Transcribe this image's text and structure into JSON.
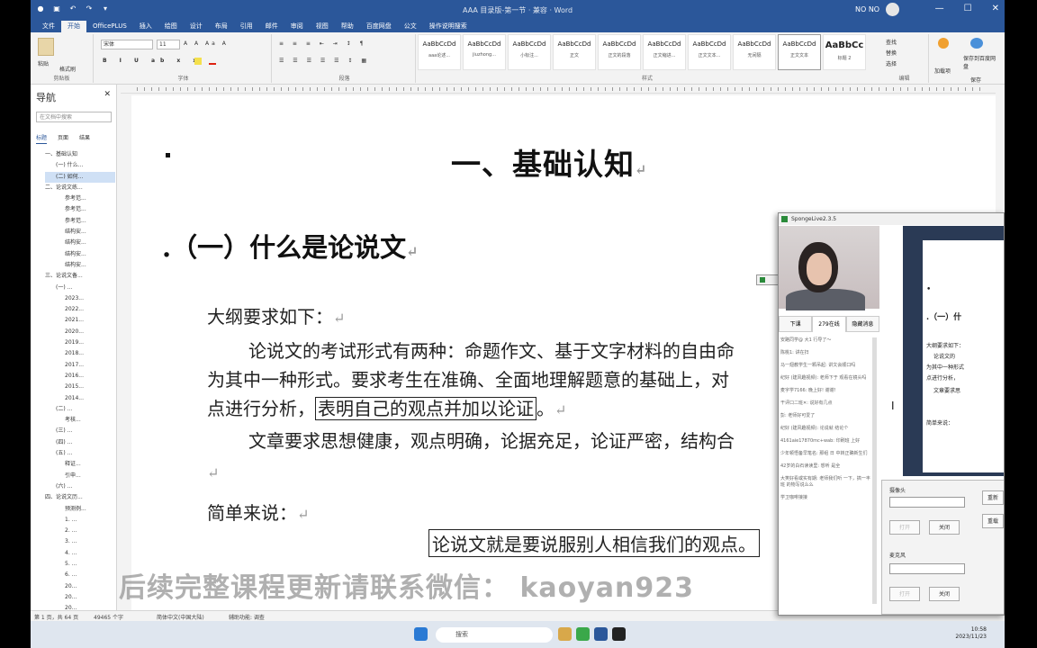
{
  "window": {
    "title": "AAA 目录版-第一节 · 兼容 · Word",
    "user": "NO NO"
  },
  "ribbon_tabs": [
    "文件",
    "开始",
    "OfficePLUS",
    "插入",
    "绘图",
    "设计",
    "布局",
    "引用",
    "邮件",
    "审阅",
    "视图",
    "帮助",
    "百度网盘",
    "公文",
    "操作说明搜索"
  ],
  "ribbon": {
    "clipboard": {
      "paste": "粘贴",
      "format_painter": "格式刷",
      "label": "剪贴板"
    },
    "font": {
      "name": "宋体",
      "size": "11",
      "label": "字体"
    },
    "paragraph": {
      "label": "段落"
    },
    "styles": {
      "label": "样式",
      "items": [
        {
          "sample": "AaBbCcDd",
          "name": "aaa论述..."
        },
        {
          "sample": "AaBbCcDd",
          "name": "jiuzhong..."
        },
        {
          "sample": "AaBbCcDd",
          "name": "小标注..."
        },
        {
          "sample": "AaBbCcDd",
          "name": "正文"
        },
        {
          "sample": "AaBbCcDd",
          "name": "正文的段落"
        },
        {
          "sample": "AaBbCcDd",
          "name": "正文缩进..."
        },
        {
          "sample": "AaBbCcDd",
          "name": "正文文本..."
        },
        {
          "sample": "AaBbCcDd",
          "name": "无间隔"
        },
        {
          "sample": "AaBbCcDd",
          "name": "正文文本"
        },
        {
          "sample": "AaBbCc",
          "name": "标题 2"
        },
        {
          "sample": "AaBbCc",
          "name": "标题 3"
        }
      ]
    },
    "editing": {
      "find": "查找",
      "replace": "替换",
      "select": "选择",
      "label": "编辑"
    },
    "addins": {
      "label1": "加载项",
      "label2": "保存到百度网盘",
      "label3": "保存"
    }
  },
  "nav": {
    "title": "导航",
    "search_placeholder": "在文档中搜索",
    "tabs": [
      "标题",
      "页面",
      "结果"
    ],
    "tree": [
      "一、基础认知",
      "(一) 什么...",
      "(二) 如何...",
      "二、论说文练...",
      "参考范...",
      "参考范...",
      "参考范...",
      "结构安...",
      "结构安...",
      "结构安...",
      "结构安...",
      "三、论说文备...",
      "(一) ...",
      "2023...",
      "2022...",
      "2021...",
      "2020...",
      "2019...",
      "2018...",
      "2017...",
      "2016...",
      "2015...",
      "2014...",
      "(二) ...",
      "考核...",
      "(三) ...",
      "(四) ...",
      "(五) ...",
      "释证...",
      "引申...",
      "(六) ...",
      "四、论说文历...",
      "预测例...",
      "1. ...",
      "2. ...",
      "3. ...",
      "4. ...",
      "5. ...",
      "6. ...",
      "20...",
      "20...",
      "20..."
    ]
  },
  "document": {
    "heading1": "一、基础认知",
    "heading2": ".（一）什么是论说文",
    "outline_label": "大纲要求如下：",
    "para1_line1": "论说文的考试形式有两种：命题作文、基于文字材料的自由命",
    "para1_line2": "为其中一种形式。要求考生在准确、全面地理解题意的基础上，对",
    "para1_line3_pre": "点进行分析，",
    "para1_line3_boxed": "表明自己的观点并加以论证",
    "para1_line3_post": "。",
    "para2": "文章要求思想健康，观点明确，论据充足，论证严密，结构合",
    "simple_label": "简单来说：",
    "boxed_quote": "论说文就是要说服别人相信我们的观点。",
    "para_mark": "↵"
  },
  "statusbar": {
    "page": "第 1 页，共 64 页",
    "words": "49465 个字",
    "lang": "简体中文(中国大陆)",
    "accessibility": "辅助功能: 调查"
  },
  "taskbar": {
    "search": "搜索",
    "time": "10:58",
    "date": "2023/11/23"
  },
  "watermark": "后续完整课程更新请联系微信：  kaoyan923",
  "live_overlay": {
    "title": "SpongeLive2.3.5",
    "tabs": [
      "下课",
      "279在线",
      "隐藏消息"
    ],
    "chat": [
      "安路同学@ 大1 行导了～",
      "陈桃1: 讲在扫",
      "马一翅教学生一颗吊起: 讲文会顺口吗",
      "纪好 (建风趣视频): 老师下于 观看在镜头吗",
      "麦字学7166: 晚上好! 谢谢!",
      "干评口二班✕: 说好有几点",
      "彭: 老师好可爱了",
      "纪好 (建风趣视频): 论说就 结论个",
      "4161aie17870mc+wab: 印刷班 上好",
      "少年顿悟备早笔名: 那组 日 中转正确新生们",
      "42岁的白石读读里: 想听 是全",
      "大笑好看或实有期: 老师我们听 一下，搞一丰班 的物写说么么",
      "学卫咖啡接接"
    ],
    "thumb": {
      "line1": ".（一）什",
      "line2": "大纲要求如下：",
      "line3": "论说文的",
      "line4": "为其中一种形式",
      "line5": "点进行分析，",
      "line6": "文章要求思",
      "line7": "简单来说："
    },
    "panel": {
      "camera_label": "摄像头",
      "mic_label": "麦克风",
      "open_btn": "打开",
      "close_btn": "关闭",
      "open_btn2": "打开",
      "close_btn2": "关闭",
      "refresh_btn": "重载",
      "restart_btn": "重新"
    }
  }
}
